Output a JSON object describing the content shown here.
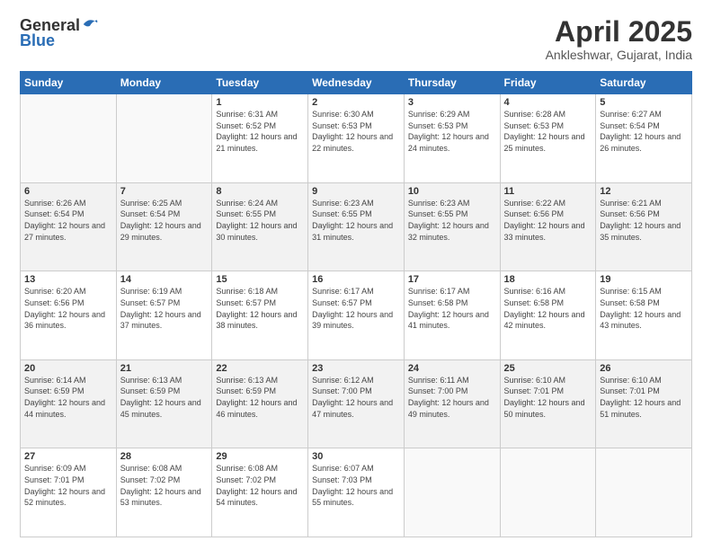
{
  "header": {
    "logo_general": "General",
    "logo_blue": "Blue",
    "month_title": "April 2025",
    "location": "Ankleshwar, Gujarat, India"
  },
  "days_of_week": [
    "Sunday",
    "Monday",
    "Tuesday",
    "Wednesday",
    "Thursday",
    "Friday",
    "Saturday"
  ],
  "weeks": [
    [
      {
        "day": "",
        "sunrise": "",
        "sunset": "",
        "daylight": ""
      },
      {
        "day": "",
        "sunrise": "",
        "sunset": "",
        "daylight": ""
      },
      {
        "day": "1",
        "sunrise": "Sunrise: 6:31 AM",
        "sunset": "Sunset: 6:52 PM",
        "daylight": "Daylight: 12 hours and 21 minutes."
      },
      {
        "day": "2",
        "sunrise": "Sunrise: 6:30 AM",
        "sunset": "Sunset: 6:53 PM",
        "daylight": "Daylight: 12 hours and 22 minutes."
      },
      {
        "day": "3",
        "sunrise": "Sunrise: 6:29 AM",
        "sunset": "Sunset: 6:53 PM",
        "daylight": "Daylight: 12 hours and 24 minutes."
      },
      {
        "day": "4",
        "sunrise": "Sunrise: 6:28 AM",
        "sunset": "Sunset: 6:53 PM",
        "daylight": "Daylight: 12 hours and 25 minutes."
      },
      {
        "day": "5",
        "sunrise": "Sunrise: 6:27 AM",
        "sunset": "Sunset: 6:54 PM",
        "daylight": "Daylight: 12 hours and 26 minutes."
      }
    ],
    [
      {
        "day": "6",
        "sunrise": "Sunrise: 6:26 AM",
        "sunset": "Sunset: 6:54 PM",
        "daylight": "Daylight: 12 hours and 27 minutes."
      },
      {
        "day": "7",
        "sunrise": "Sunrise: 6:25 AM",
        "sunset": "Sunset: 6:54 PM",
        "daylight": "Daylight: 12 hours and 29 minutes."
      },
      {
        "day": "8",
        "sunrise": "Sunrise: 6:24 AM",
        "sunset": "Sunset: 6:55 PM",
        "daylight": "Daylight: 12 hours and 30 minutes."
      },
      {
        "day": "9",
        "sunrise": "Sunrise: 6:23 AM",
        "sunset": "Sunset: 6:55 PM",
        "daylight": "Daylight: 12 hours and 31 minutes."
      },
      {
        "day": "10",
        "sunrise": "Sunrise: 6:23 AM",
        "sunset": "Sunset: 6:55 PM",
        "daylight": "Daylight: 12 hours and 32 minutes."
      },
      {
        "day": "11",
        "sunrise": "Sunrise: 6:22 AM",
        "sunset": "Sunset: 6:56 PM",
        "daylight": "Daylight: 12 hours and 33 minutes."
      },
      {
        "day": "12",
        "sunrise": "Sunrise: 6:21 AM",
        "sunset": "Sunset: 6:56 PM",
        "daylight": "Daylight: 12 hours and 35 minutes."
      }
    ],
    [
      {
        "day": "13",
        "sunrise": "Sunrise: 6:20 AM",
        "sunset": "Sunset: 6:56 PM",
        "daylight": "Daylight: 12 hours and 36 minutes."
      },
      {
        "day": "14",
        "sunrise": "Sunrise: 6:19 AM",
        "sunset": "Sunset: 6:57 PM",
        "daylight": "Daylight: 12 hours and 37 minutes."
      },
      {
        "day": "15",
        "sunrise": "Sunrise: 6:18 AM",
        "sunset": "Sunset: 6:57 PM",
        "daylight": "Daylight: 12 hours and 38 minutes."
      },
      {
        "day": "16",
        "sunrise": "Sunrise: 6:17 AM",
        "sunset": "Sunset: 6:57 PM",
        "daylight": "Daylight: 12 hours and 39 minutes."
      },
      {
        "day": "17",
        "sunrise": "Sunrise: 6:17 AM",
        "sunset": "Sunset: 6:58 PM",
        "daylight": "Daylight: 12 hours and 41 minutes."
      },
      {
        "day": "18",
        "sunrise": "Sunrise: 6:16 AM",
        "sunset": "Sunset: 6:58 PM",
        "daylight": "Daylight: 12 hours and 42 minutes."
      },
      {
        "day": "19",
        "sunrise": "Sunrise: 6:15 AM",
        "sunset": "Sunset: 6:58 PM",
        "daylight": "Daylight: 12 hours and 43 minutes."
      }
    ],
    [
      {
        "day": "20",
        "sunrise": "Sunrise: 6:14 AM",
        "sunset": "Sunset: 6:59 PM",
        "daylight": "Daylight: 12 hours and 44 minutes."
      },
      {
        "day": "21",
        "sunrise": "Sunrise: 6:13 AM",
        "sunset": "Sunset: 6:59 PM",
        "daylight": "Daylight: 12 hours and 45 minutes."
      },
      {
        "day": "22",
        "sunrise": "Sunrise: 6:13 AM",
        "sunset": "Sunset: 6:59 PM",
        "daylight": "Daylight: 12 hours and 46 minutes."
      },
      {
        "day": "23",
        "sunrise": "Sunrise: 6:12 AM",
        "sunset": "Sunset: 7:00 PM",
        "daylight": "Daylight: 12 hours and 47 minutes."
      },
      {
        "day": "24",
        "sunrise": "Sunrise: 6:11 AM",
        "sunset": "Sunset: 7:00 PM",
        "daylight": "Daylight: 12 hours and 49 minutes."
      },
      {
        "day": "25",
        "sunrise": "Sunrise: 6:10 AM",
        "sunset": "Sunset: 7:01 PM",
        "daylight": "Daylight: 12 hours and 50 minutes."
      },
      {
        "day": "26",
        "sunrise": "Sunrise: 6:10 AM",
        "sunset": "Sunset: 7:01 PM",
        "daylight": "Daylight: 12 hours and 51 minutes."
      }
    ],
    [
      {
        "day": "27",
        "sunrise": "Sunrise: 6:09 AM",
        "sunset": "Sunset: 7:01 PM",
        "daylight": "Daylight: 12 hours and 52 minutes."
      },
      {
        "day": "28",
        "sunrise": "Sunrise: 6:08 AM",
        "sunset": "Sunset: 7:02 PM",
        "daylight": "Daylight: 12 hours and 53 minutes."
      },
      {
        "day": "29",
        "sunrise": "Sunrise: 6:08 AM",
        "sunset": "Sunset: 7:02 PM",
        "daylight": "Daylight: 12 hours and 54 minutes."
      },
      {
        "day": "30",
        "sunrise": "Sunrise: 6:07 AM",
        "sunset": "Sunset: 7:03 PM",
        "daylight": "Daylight: 12 hours and 55 minutes."
      },
      {
        "day": "",
        "sunrise": "",
        "sunset": "",
        "daylight": ""
      },
      {
        "day": "",
        "sunrise": "",
        "sunset": "",
        "daylight": ""
      },
      {
        "day": "",
        "sunrise": "",
        "sunset": "",
        "daylight": ""
      }
    ]
  ]
}
